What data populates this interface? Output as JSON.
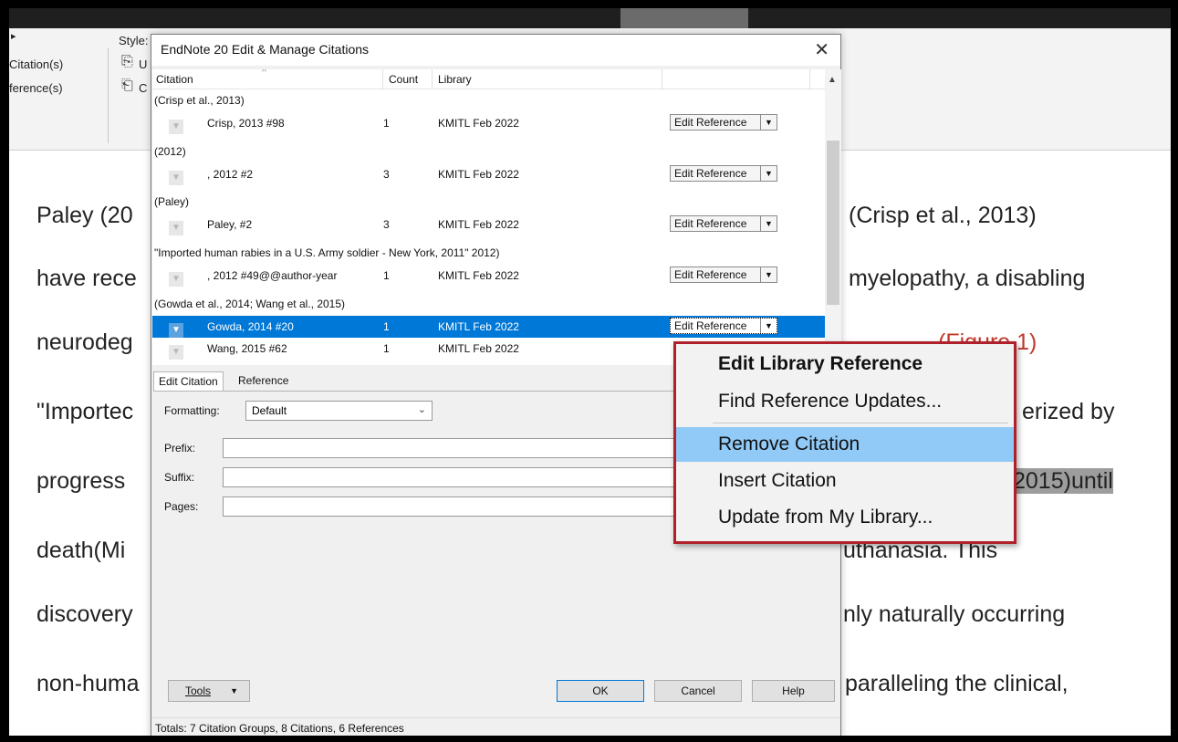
{
  "ribbon": {
    "style_label": "Style:",
    "item_citations": "Citation(s)",
    "item_references": "ference(s)",
    "update_label": "U",
    "convert_label": "C"
  },
  "document": {
    "lines": [
      {
        "left": "Paley (20",
        "right": "(Crisp et al., 2013)"
      },
      {
        "left": "have rece",
        "right": "myelopathy, a disabling"
      },
      {
        "left": "neurodeg",
        "right": "(Figure 1)"
      },
      {
        "left": "\"Importec",
        "right": "erized by"
      },
      {
        "left": "progress",
        "right": "2015)until"
      },
      {
        "left": "death(Mi",
        "right": "uthanasia. This"
      },
      {
        "left": "discovery",
        "right": "nly naturally occurring"
      },
      {
        "left": "non-huma",
        "right": "paralleling the clinical,"
      }
    ]
  },
  "dialog": {
    "title": "EndNote 20 Edit & Manage Citations",
    "close_label": "✕",
    "columns": {
      "citation": "Citation",
      "count": "Count",
      "library": "Library"
    },
    "groups": [
      {
        "label": "(Crisp et al., 2013)",
        "items": [
          {
            "citation": "Crisp, 2013 #98",
            "count": "1",
            "library": "KMITL Feb 2022",
            "action": "Edit Reference"
          }
        ]
      },
      {
        "label": "(2012)",
        "items": [
          {
            "citation": ", 2012 #2",
            "count": "3",
            "library": "KMITL Feb 2022",
            "action": "Edit Reference"
          }
        ]
      },
      {
        "label": "(Paley)",
        "items": [
          {
            "citation": "Paley,  #2",
            "count": "3",
            "library": "KMITL Feb 2022",
            "action": "Edit Reference"
          }
        ]
      },
      {
        "label": "\"Imported human rabies in a U.S. Army soldier - New York, 2011\" 2012)",
        "items": [
          {
            "citation": ", 2012 #49@@author-year",
            "count": "1",
            "library": "KMITL Feb 2022",
            "action": "Edit Reference"
          }
        ]
      },
      {
        "label": "(Gowda et al., 2014; Wang et al., 2015)",
        "items": [
          {
            "citation": "Gowda, 2014 #20",
            "count": "1",
            "library": "KMITL Feb 2022",
            "action": "Edit Reference"
          },
          {
            "citation": "Wang, 2015 #62",
            "count": "1",
            "library": "KMITL Feb 2022",
            "action": ""
          }
        ]
      }
    ],
    "tabs": [
      "Edit Citation",
      "Reference"
    ],
    "formatting_label": "Formatting:",
    "formatting_value": "Default",
    "prefix_label": "Prefix:",
    "suffix_label": "Suffix:",
    "pages_label": "Pages:",
    "tools_label": "Tools",
    "ok_label": "OK",
    "cancel_label": "Cancel",
    "help_label": "Help",
    "status": "Totals: 7 Citation Groups, 8 Citations, 6 References"
  },
  "context_menu": {
    "items": [
      {
        "label": "Edit Library Reference",
        "bold": true,
        "highlighted": false
      },
      {
        "label": "Find Reference Updates...",
        "bold": false,
        "highlighted": false
      },
      {
        "label": "Remove Citation",
        "bold": false,
        "highlighted": true
      },
      {
        "label": "Insert Citation",
        "bold": false,
        "highlighted": false
      },
      {
        "label": "Update from My Library...",
        "bold": false,
        "highlighted": false
      }
    ]
  },
  "colors": {
    "selection": "#0078d7",
    "menu_highlight": "#91c9f7",
    "menu_border": "#b0202a"
  }
}
